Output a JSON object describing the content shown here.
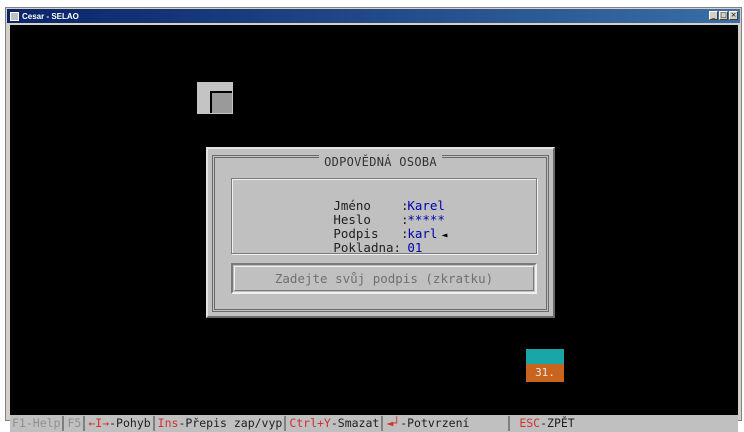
{
  "window": {
    "title": "Cesar - SELAO",
    "controls": [
      "_",
      "□",
      "×"
    ]
  },
  "dialog": {
    "title": "ODPOVĚDNÁ OSOBA",
    "fields": [
      {
        "label": "Jméno    :",
        "value": "Karel"
      },
      {
        "label": "Heslo    :",
        "value": "*****"
      },
      {
        "label": "Podpis   :",
        "value": "karl"
      },
      {
        "label": "Pokladna:",
        "value": "01"
      }
    ],
    "active_marker": "◄",
    "hint": "Zadejte svůj podpis (zkratku)"
  },
  "calendar": {
    "day": "31."
  },
  "statusbar": {
    "items": [
      {
        "key": "F1",
        "text": "-Help"
      },
      {
        "key": "F5",
        "text": ""
      },
      {
        "key": "←I→",
        "text": "-Pohyb"
      },
      {
        "key": "Ins",
        "text": "-Přepis zap/vyp"
      },
      {
        "key": "Ctrl+Y",
        "text": "-Smazat"
      },
      {
        "key": "◄┘",
        "text": "-Potvrzení"
      },
      {
        "key": "ESC",
        "text": "-ZPĚT"
      }
    ]
  },
  "colors": {
    "console_bg": "#000000",
    "dialog_bg": "#c0c0c0",
    "value_text": "#0000b0",
    "hotkey": "#d03030",
    "calendar_top": "#1aa6a6",
    "calendar_bottom": "#c8641c"
  }
}
